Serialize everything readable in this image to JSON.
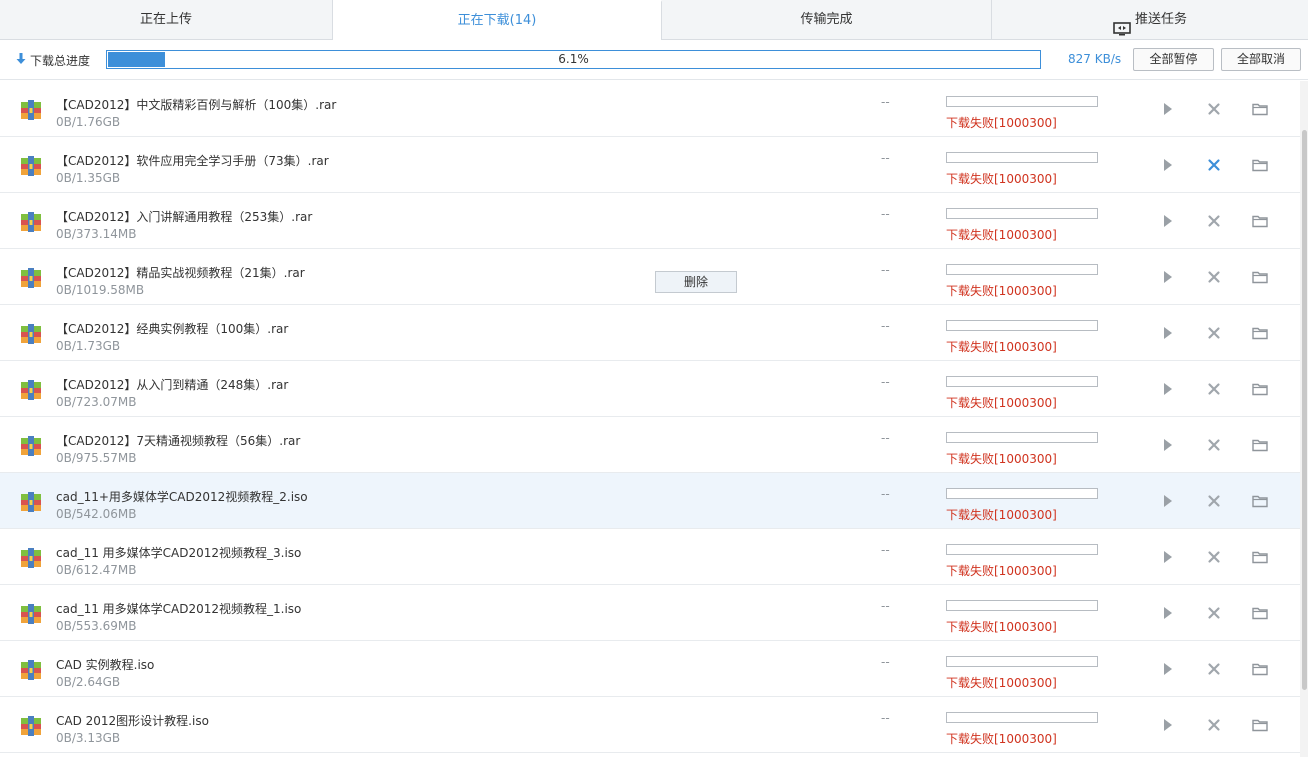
{
  "tabs": [
    {
      "label": "正在上传"
    },
    {
      "label": "正在下载(14)"
    },
    {
      "label": "传输完成"
    },
    {
      "label": "推送任务"
    }
  ],
  "total": {
    "label": "下载总进度",
    "percent_text": "6.1%",
    "percent": 6.1,
    "speed": "827 KB/s",
    "pause_all": "全部暂停",
    "cancel_all": "全部取消"
  },
  "tooltip": "删除",
  "colors": {
    "accent": "#3d8fd9",
    "error": "#d0331f"
  },
  "files": [
    {
      "name": "【CAD2012】中文版精彩百例与解析（100集）.rar",
      "size": "0B/1.76GB",
      "speed": "--",
      "status": "下载失败[1000300]"
    },
    {
      "name": "【CAD2012】软件应用完全学习手册（73集）.rar",
      "size": "0B/1.35GB",
      "speed": "--",
      "status": "下载失败[1000300]"
    },
    {
      "name": "【CAD2012】入门讲解通用教程（253集）.rar",
      "size": "0B/373.14MB",
      "speed": "--",
      "status": "下载失败[1000300]"
    },
    {
      "name": "【CAD2012】精品实战视频教程（21集）.rar",
      "size": "0B/1019.58MB",
      "speed": "--",
      "status": "下载失败[1000300]"
    },
    {
      "name": "【CAD2012】经典实例教程（100集）.rar",
      "size": "0B/1.73GB",
      "speed": "--",
      "status": "下载失败[1000300]"
    },
    {
      "name": "【CAD2012】从入门到精通（248集）.rar",
      "size": "0B/723.07MB",
      "speed": "--",
      "status": "下载失败[1000300]"
    },
    {
      "name": "【CAD2012】7天精通视频教程（56集）.rar",
      "size": "0B/975.57MB",
      "speed": "--",
      "status": "下载失败[1000300]"
    },
    {
      "name": "cad_11+用多媒体学CAD2012视频教程_2.iso",
      "size": "0B/542.06MB",
      "speed": "--",
      "status": "下载失败[1000300]"
    },
    {
      "name": "cad_11 用多媒体学CAD2012视频教程_3.iso",
      "size": "0B/612.47MB",
      "speed": "--",
      "status": "下载失败[1000300]"
    },
    {
      "name": "cad_11 用多媒体学CAD2012视频教程_1.iso",
      "size": "0B/553.69MB",
      "speed": "--",
      "status": "下载失败[1000300]"
    },
    {
      "name": "CAD 实例教程.iso",
      "size": "0B/2.64GB",
      "speed": "--",
      "status": "下载失败[1000300]"
    },
    {
      "name": "CAD 2012图形设计教程.iso",
      "size": "0B/3.13GB",
      "speed": "--",
      "status": "下载失败[1000300]"
    }
  ]
}
